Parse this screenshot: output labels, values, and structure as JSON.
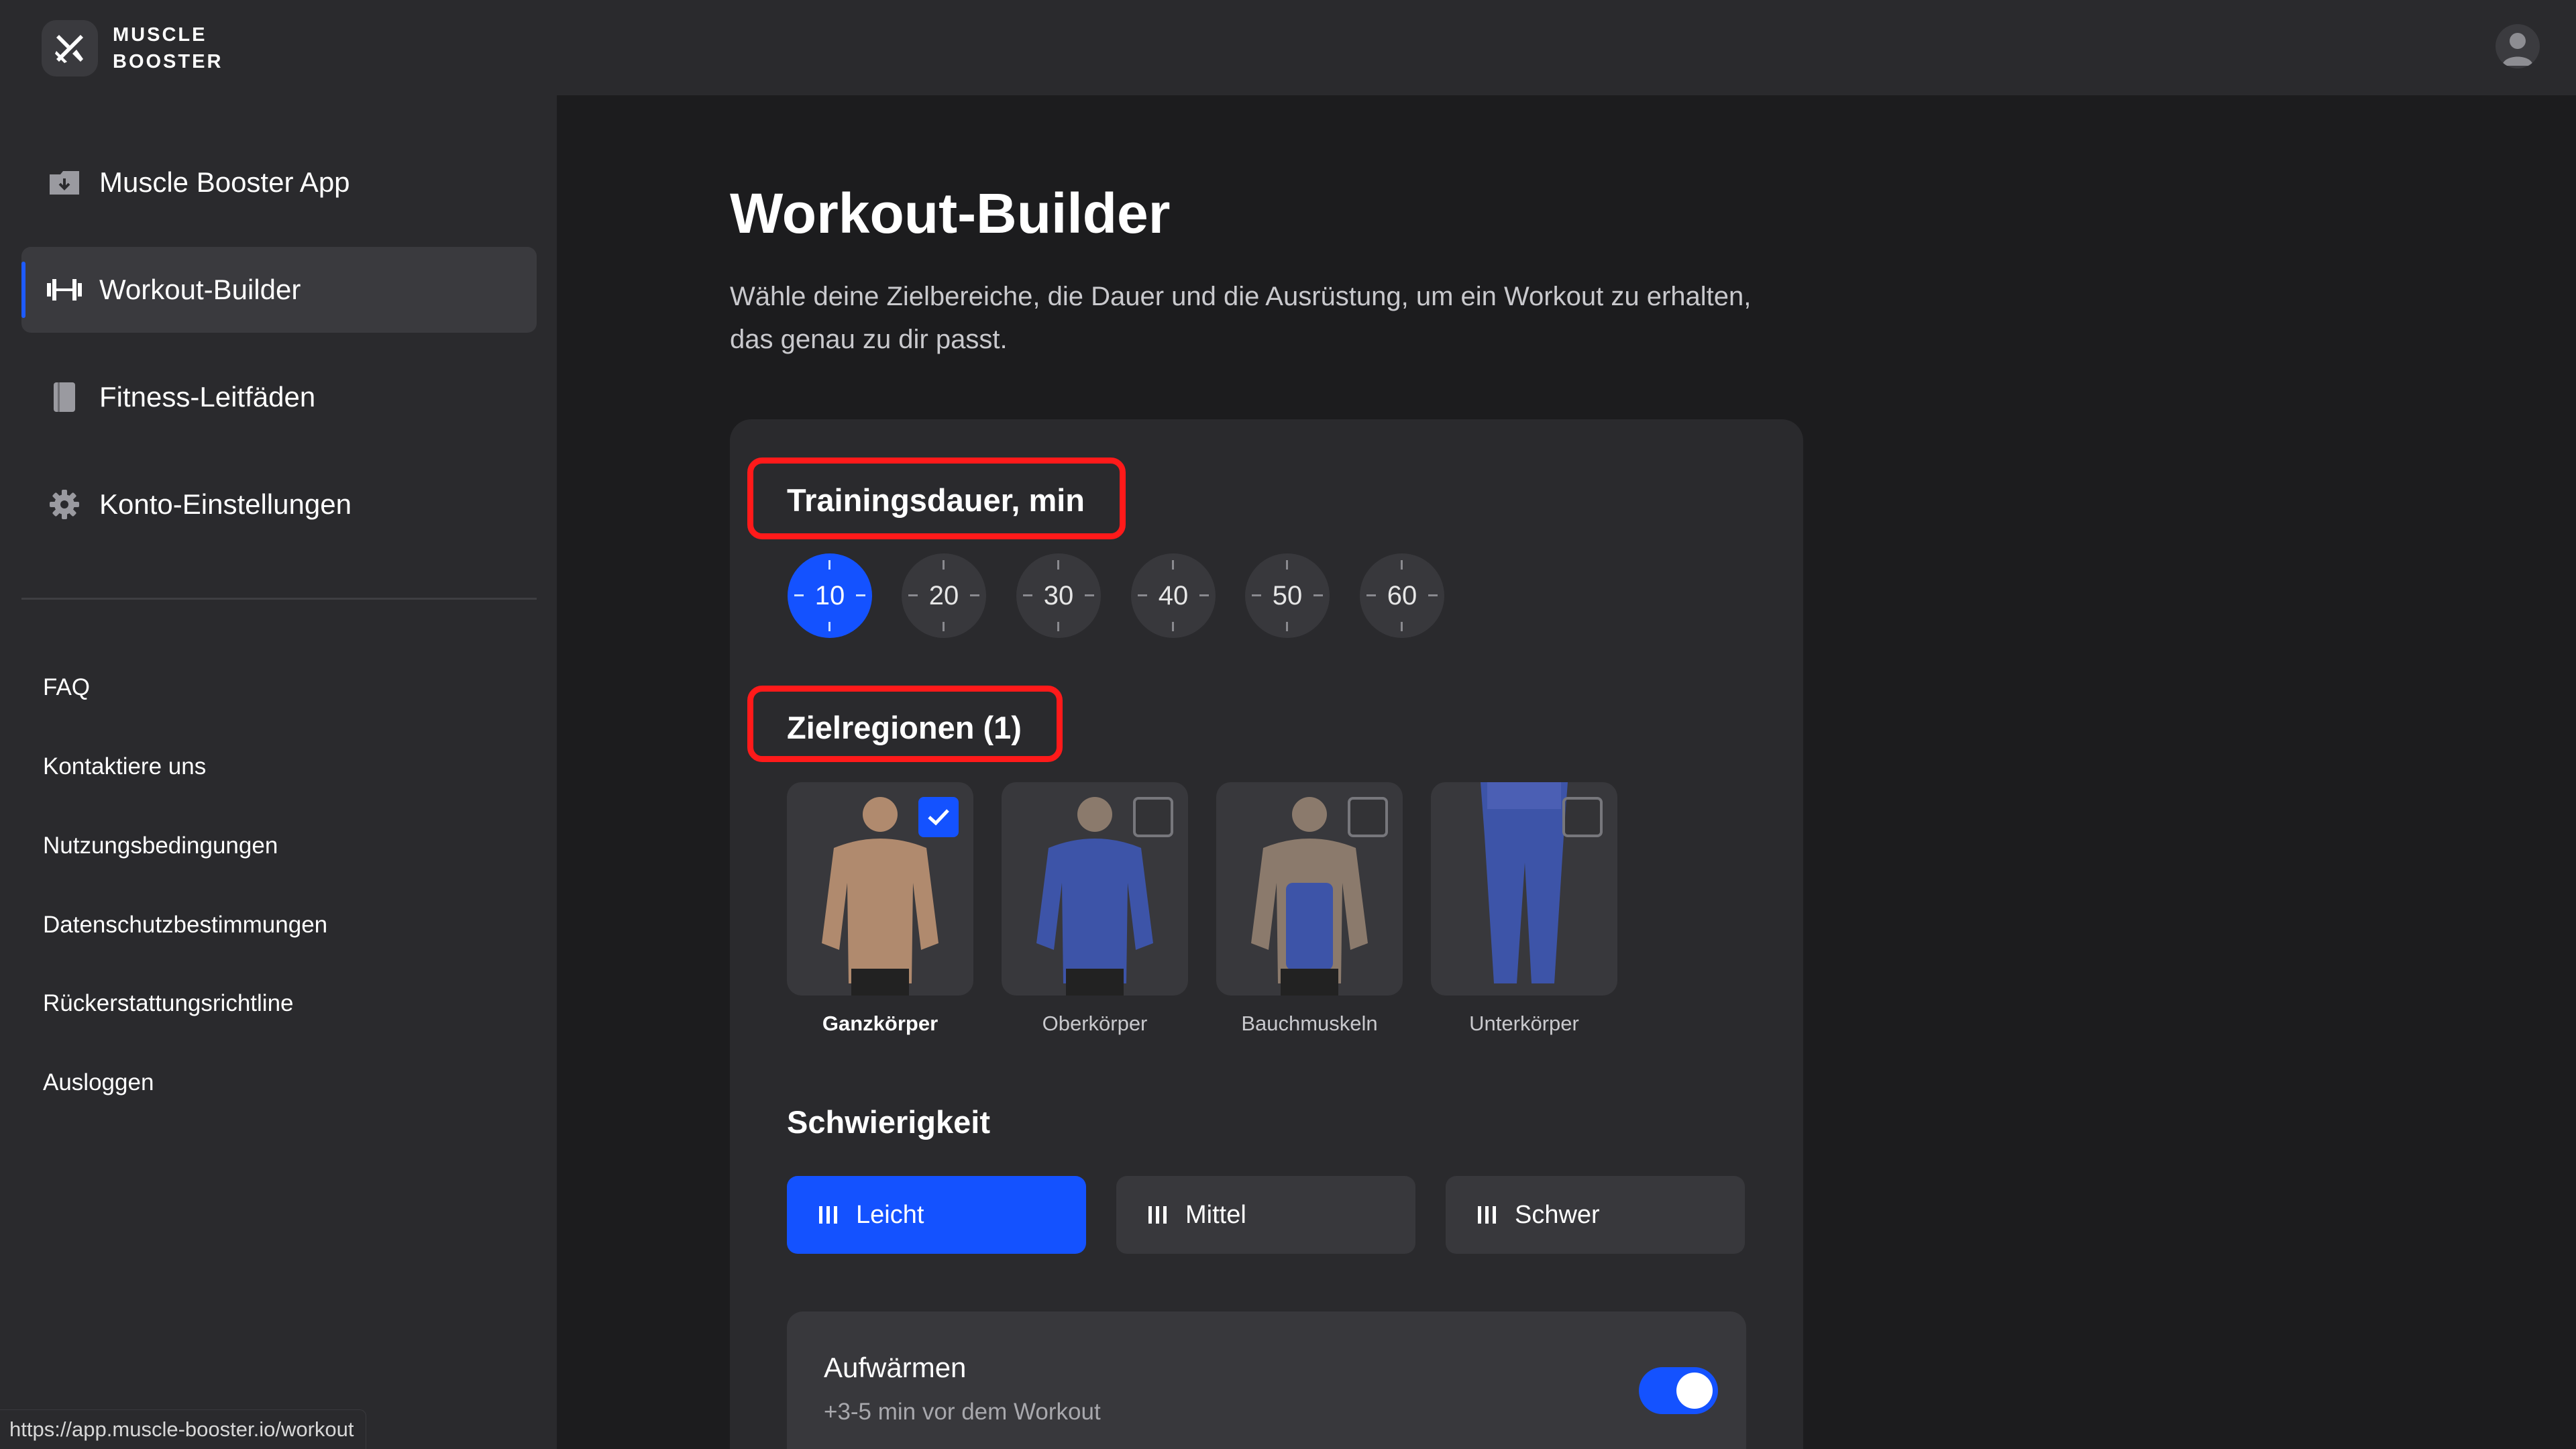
{
  "brand": {
    "line1": "MUSCLE",
    "line2": "BOOSTER"
  },
  "sidebar": {
    "items": [
      {
        "label": "Muscle Booster App",
        "icon": "app-icon",
        "active": false
      },
      {
        "label": "Workout-Builder",
        "icon": "dumbbell-icon",
        "active": true
      },
      {
        "label": "Fitness-Leitfäden",
        "icon": "book-icon",
        "active": false
      },
      {
        "label": "Konto-Einstellungen",
        "icon": "gear-icon",
        "active": false
      }
    ],
    "links": [
      "FAQ",
      "Kontaktiere uns",
      "Nutzungsbedingungen",
      "Datenschutzbestimmungen",
      "Rückerstattungsrichtline",
      "Ausloggen"
    ]
  },
  "status_url": "https://app.muscle-booster.io/workout",
  "main": {
    "title": "Workout-Builder",
    "subtitle": "Wähle deine Zielbereiche, die Dauer und die Ausrüstung, um ein Workout zu erhalten, das genau zu dir passt.",
    "duration": {
      "title": "Trainingsdauer, min",
      "options": [
        "10",
        "20",
        "30",
        "40",
        "50",
        "60"
      ],
      "selected": "10"
    },
    "regions": {
      "title": "Zielregionen (1)",
      "items": [
        {
          "label": "Ganzkörper",
          "checked": true
        },
        {
          "label": "Oberkörper",
          "checked": false
        },
        {
          "label": "Bauchmuskeln",
          "checked": false
        },
        {
          "label": "Unterkörper",
          "checked": false
        }
      ]
    },
    "difficulty": {
      "title": "Schwierigkeit",
      "options": [
        "Leicht",
        "Mittel",
        "Schwer"
      ],
      "selected": "Leicht"
    },
    "warmup": {
      "title": "Aufwärmen",
      "subtitle": "+3-5 min vor dem Workout",
      "enabled": true
    }
  },
  "colors": {
    "accent": "#1452ff",
    "highlight": "#ff1a1a",
    "background": "#1c1c1e",
    "panel": "#2a2a2d"
  }
}
